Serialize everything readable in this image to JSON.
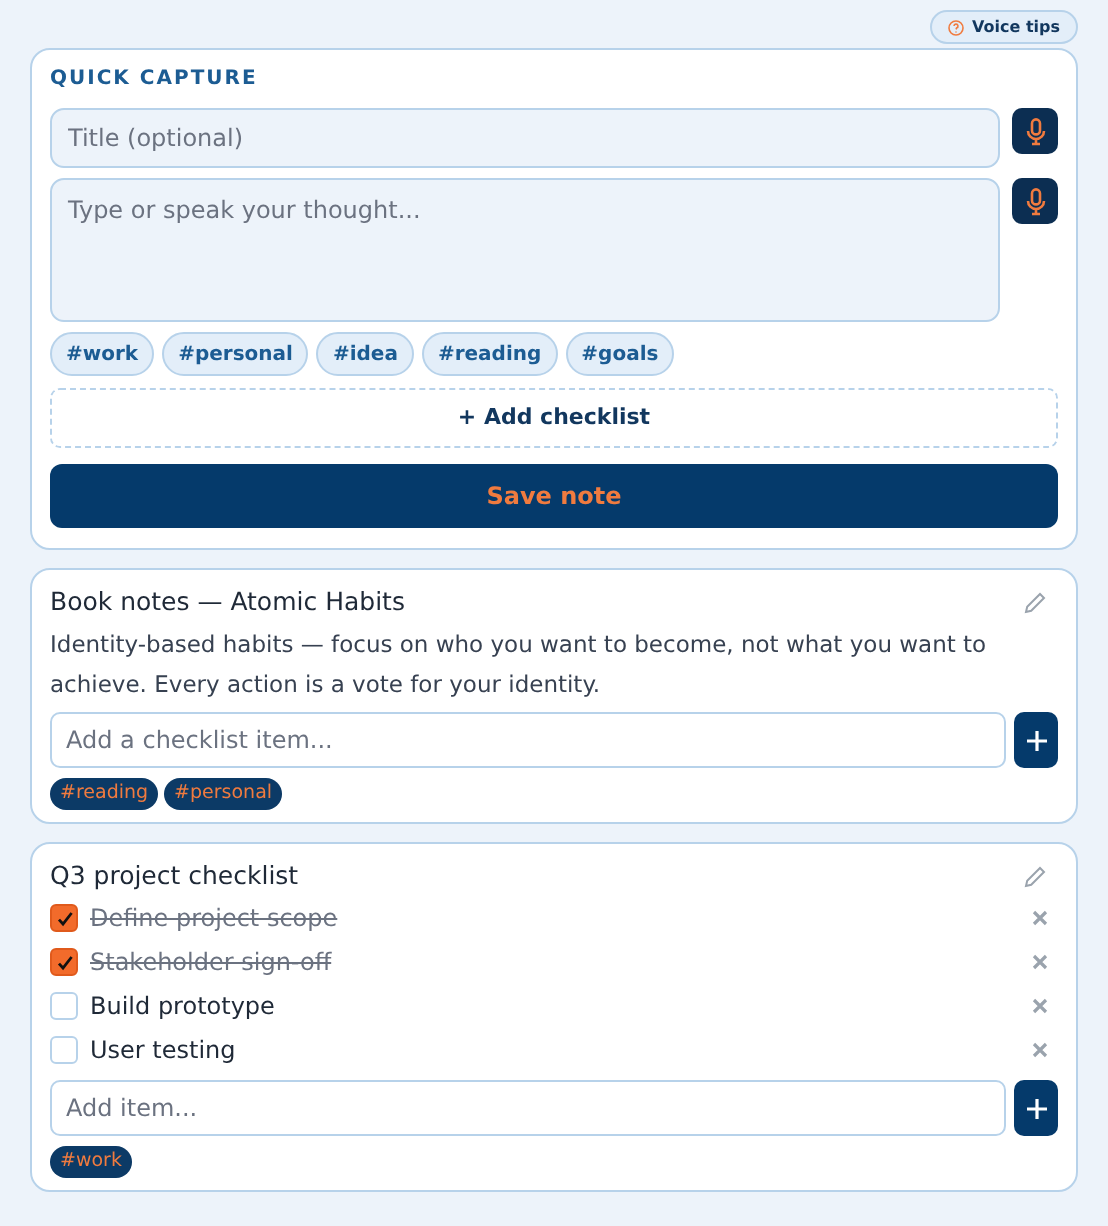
{
  "voice_tips": {
    "label": "Voice tips"
  },
  "quick_capture": {
    "heading": "QUICK CAPTURE",
    "title_field": {
      "placeholder": "Title (optional)"
    },
    "body_field": {
      "placeholder": "Type or speak your thought..."
    },
    "tags": [
      "#work",
      "#personal",
      "#idea",
      "#reading",
      "#goals"
    ],
    "add_checklist": "+ Add checklist",
    "save": "Save note"
  },
  "notes": [
    {
      "kind": "text",
      "title": "Book notes — Atomic Habits",
      "body": "Identity-based habits — focus on who you want to become, not what you want to achieve. Every action is a vote for your identity.",
      "input": {
        "placeholder": "Add a checklist item..."
      },
      "tags": [
        "#reading",
        "#personal"
      ]
    },
    {
      "kind": "checklist",
      "title": "Q3 project checklist",
      "items": [
        {
          "label": "Define project scope",
          "checked": true
        },
        {
          "label": "Stakeholder sign-off",
          "checked": true
        },
        {
          "label": "Build prototype",
          "checked": false
        },
        {
          "label": "User testing",
          "checked": false
        }
      ],
      "input": {
        "placeholder": "Add item..."
      },
      "tags": [
        "#work"
      ]
    }
  ]
}
